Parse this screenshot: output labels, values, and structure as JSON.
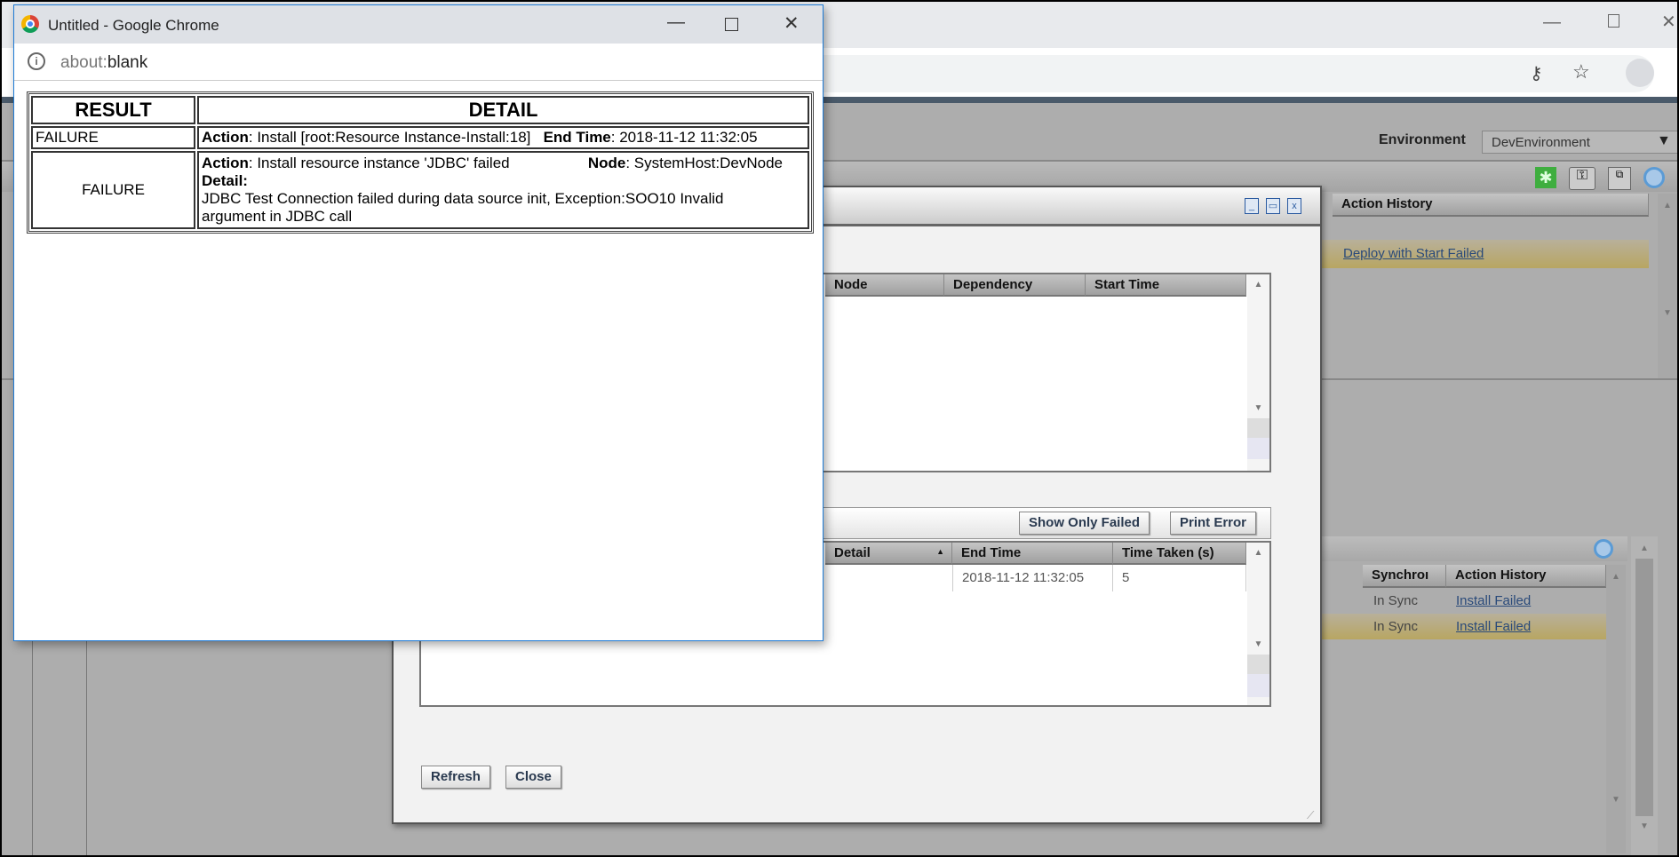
{
  "background_browser": {
    "window_controls": [
      "minimize",
      "restore",
      "close"
    ]
  },
  "app": {
    "environment_label": "Environment",
    "environment_value": "DevEnvironment",
    "top_grid": {
      "header": "Action History",
      "rows": [
        {
          "action_history": ""
        },
        {
          "action_history": "Deploy with Start Failed"
        }
      ]
    },
    "bottom_grid": {
      "headers": [
        "Synchroı",
        "Action History"
      ],
      "rows": [
        {
          "sync": "In Sync",
          "action_history": "Install Failed"
        },
        {
          "sync": "In Sync",
          "action_history": "Install Failed"
        }
      ]
    }
  },
  "modal": {
    "upper_grid": {
      "headers": [
        "Node",
        "Dependency",
        "Start Time"
      ]
    },
    "lower_toolbar": {
      "show_only_failed": "Show Only Failed",
      "print_error": "Print Error"
    },
    "lower_grid": {
      "headers": [
        "Detail",
        "End Time",
        "Time Taken (s)"
      ],
      "rows": [
        {
          "detail": "",
          "end_time": "2018-11-12 11:32:05",
          "time_taken": "5"
        }
      ]
    },
    "refresh": "Refresh",
    "close": "Close"
  },
  "popup": {
    "title": "Untitled - Google Chrome",
    "url_prefix": "about:",
    "url_page": "blank",
    "table": {
      "headers": [
        "RESULT",
        "DETAIL"
      ],
      "row1": {
        "result": "FAILURE",
        "action_label": "Action",
        "action": ": Install [root:Resource Instance-Install:18]",
        "end_time_label": "End Time",
        "end_time": ": 2018-11-12 11:32:05"
      },
      "row2": {
        "result": "FAILURE",
        "action_label": "Action",
        "action": ": Install resource instance 'JDBC' failed",
        "node_label": "Node",
        "node": ": SystemHost:DevNode",
        "detail_label": "Detail:",
        "detail": "JDBC Test Connection failed during data source init, Exception:SOO10 Invalid argument in JDBC call"
      }
    }
  }
}
